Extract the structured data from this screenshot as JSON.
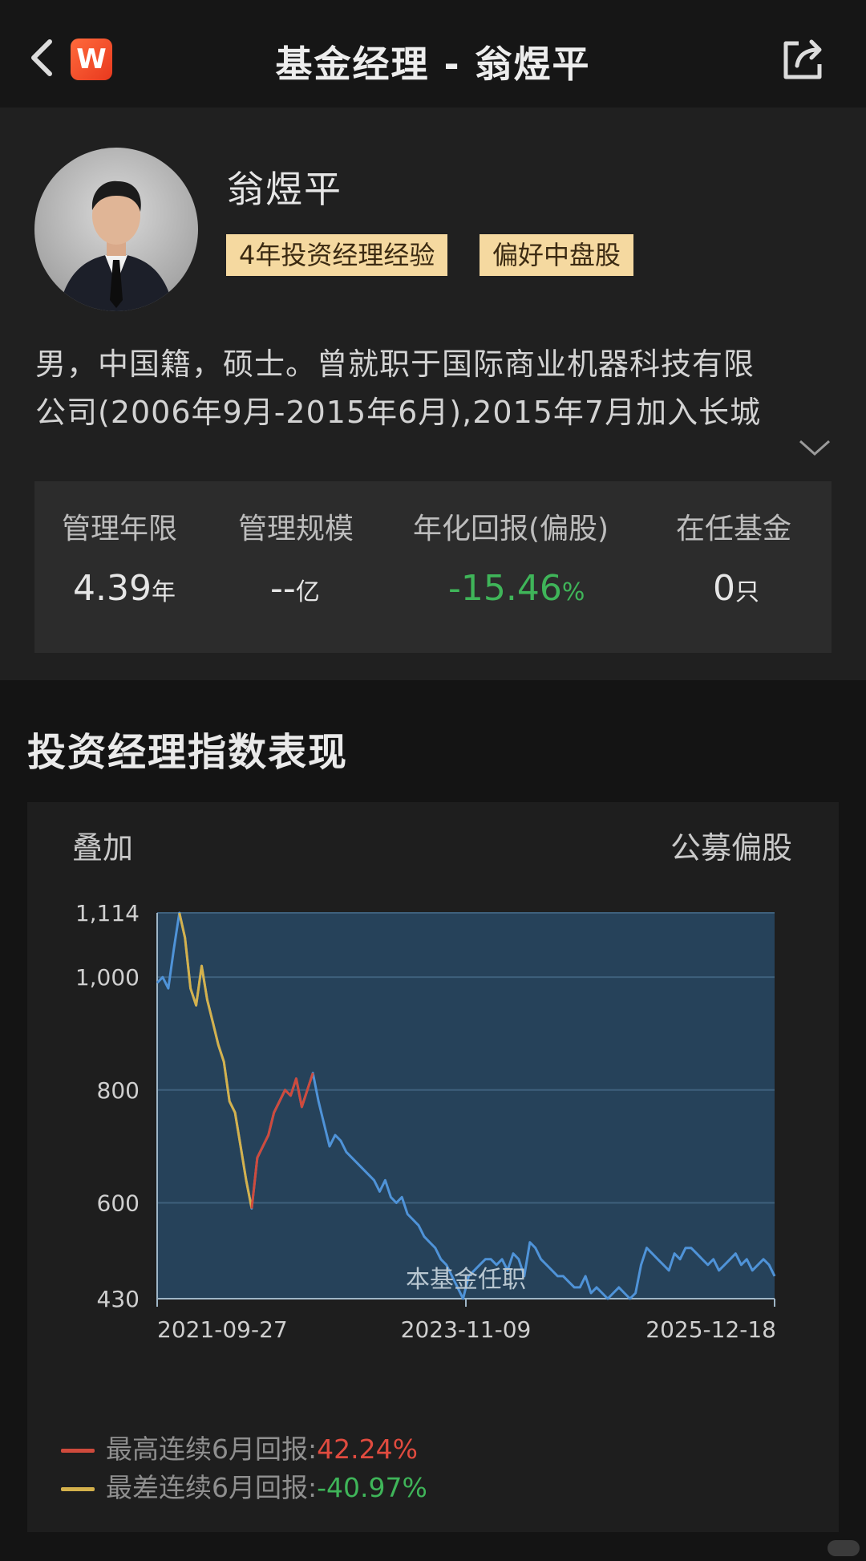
{
  "header": {
    "title": "基金经理 - 翁煜平",
    "logo_text": "W"
  },
  "manager": {
    "name": "翁煜平",
    "tags": [
      "4年投资经理经验",
      "偏好中盘股"
    ],
    "bio_lines": [
      "男，中国籍，硕士。曾就职于国际商业机器科技有限",
      "公司(2006年9月-2015年6月),2015年7月加入长城"
    ]
  },
  "stats": [
    {
      "label": "管理年限",
      "value": "4.39",
      "unit": "年"
    },
    {
      "label": "管理规模",
      "value": "--",
      "unit": "亿"
    },
    {
      "label": "年化回报(偏股)",
      "value": "-15.46",
      "unit": "%"
    },
    {
      "label": "在任基金",
      "value": "0",
      "unit": "只"
    }
  ],
  "section": {
    "title": "投资经理指数表现",
    "left": "叠加",
    "right": "公募偏股"
  },
  "chart_data": {
    "type": "line",
    "y_ticks": [
      "1,114",
      "1,000",
      "800",
      "600",
      "430"
    ],
    "x_ticks": [
      "2021-09-27",
      "2023-11-09",
      "2025-12-18"
    ],
    "annotation": "本基金任职",
    "ylim": [
      430,
      1114
    ],
    "series": [
      {
        "x": [
          "2021-09-27",
          "2021-10-11",
          "2021-10-25",
          "2021-11-08",
          "2021-11-22",
          "2021-12-06",
          "2021-12-20",
          "2022-01-04",
          "2022-01-18",
          "2022-02-01",
          "2022-02-15",
          "2022-03-01",
          "2022-03-15",
          "2022-03-29",
          "2022-04-12",
          "2022-04-26",
          "2022-05-10",
          "2022-05-24",
          "2022-06-07",
          "2022-06-21",
          "2022-07-05",
          "2022-07-19",
          "2022-08-02",
          "2022-08-16",
          "2022-08-30",
          "2022-09-13",
          "2022-09-27",
          "2022-10-11",
          "2022-10-25",
          "2022-11-08",
          "2022-11-22",
          "2022-12-06",
          "2022-12-20",
          "2023-01-03",
          "2023-01-17",
          "2023-01-31",
          "2023-02-14",
          "2023-02-28",
          "2023-03-14",
          "2023-03-28",
          "2023-04-11",
          "2023-04-25",
          "2023-05-09",
          "2023-05-23",
          "2023-06-06",
          "2023-06-20",
          "2023-07-04",
          "2023-07-18",
          "2023-08-01",
          "2023-08-15",
          "2023-08-29",
          "2023-09-12",
          "2023-09-26",
          "2023-10-10",
          "2023-10-24",
          "2023-11-07",
          "2023-11-21",
          "2023-12-05",
          "2023-12-19",
          "2024-01-02",
          "2024-01-16",
          "2024-01-30",
          "2024-02-13",
          "2024-02-27",
          "2024-03-12",
          "2024-03-26",
          "2024-04-09",
          "2024-04-23",
          "2024-05-07",
          "2024-05-21",
          "2024-06-04",
          "2024-06-18",
          "2024-07-02",
          "2024-07-16",
          "2024-07-30",
          "2024-08-13",
          "2024-08-27",
          "2024-09-10",
          "2024-09-24",
          "2024-10-08",
          "2024-10-22",
          "2024-11-05",
          "2024-11-19",
          "2024-12-03",
          "2024-12-17",
          "2024-12-31",
          "2025-01-14",
          "2025-01-28",
          "2025-02-11",
          "2025-02-25",
          "2025-03-11",
          "2025-03-25",
          "2025-04-08",
          "2025-04-22",
          "2025-05-06",
          "2025-05-20",
          "2025-06-03",
          "2025-06-17",
          "2025-07-01",
          "2025-07-15",
          "2025-07-29",
          "2025-08-12",
          "2025-08-26",
          "2025-09-09",
          "2025-09-23",
          "2025-10-07",
          "2025-10-21",
          "2025-11-04",
          "2025-11-18",
          "2025-12-02",
          "2025-12-16",
          "2025-12-18"
        ],
        "y": [
          990,
          1000,
          980,
          1050,
          1114,
          1070,
          980,
          950,
          1020,
          960,
          920,
          880,
          850,
          780,
          760,
          700,
          640,
          590,
          680,
          700,
          720,
          760,
          780,
          800,
          790,
          820,
          770,
          800,
          830,
          780,
          740,
          700,
          720,
          710,
          690,
          680,
          670,
          660,
          650,
          640,
          620,
          640,
          610,
          600,
          610,
          580,
          570,
          560,
          540,
          530,
          520,
          500,
          490,
          470,
          450,
          430,
          470,
          480,
          490,
          500,
          500,
          490,
          500,
          480,
          510,
          500,
          470,
          530,
          520,
          500,
          490,
          480,
          470,
          470,
          460,
          450,
          450,
          470,
          440,
          450,
          440,
          430,
          440,
          450,
          440,
          430,
          440,
          490,
          520,
          510,
          500,
          490,
          480,
          510,
          500,
          520,
          520,
          510,
          500,
          490,
          500,
          480,
          490,
          500,
          510,
          490,
          500,
          480,
          490,
          500,
          490,
          470
        ]
      }
    ],
    "highlights": [
      {
        "color": "#d4b14c",
        "name": "最差连续6月回报"
      },
      {
        "color": "#cf4a3c",
        "name": "最高连续6月回报"
      }
    ]
  },
  "legend": [
    {
      "label": "最高连续6月回报:",
      "value": "42.24%",
      "color": "#cf4a3c"
    },
    {
      "label": "最差连续6月回报:",
      "value": "-40.97%",
      "color": "#d4b14c"
    }
  ]
}
